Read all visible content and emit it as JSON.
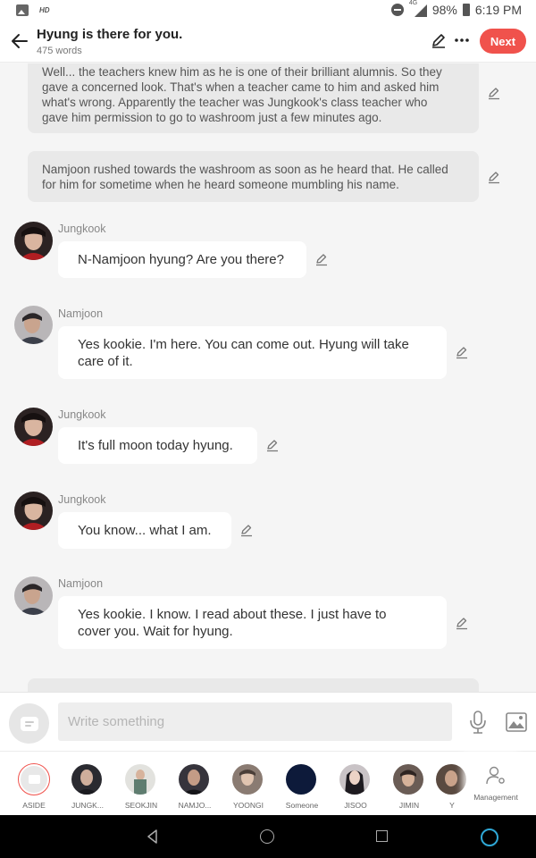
{
  "status_bar": {
    "hd": "HD",
    "network": "4G",
    "battery": "98%",
    "time": "6:19 PM"
  },
  "header": {
    "title": "Hyung is there for you.",
    "word_count": "475 words",
    "next_label": "Next"
  },
  "messages": [
    {
      "type": "narration",
      "lines": [
        "Well... the teachers knew him as he is one of their brilliant alumnis. So they",
        "gave a concerned look. That's when a teacher came to him and asked him",
        "what's wrong. Apparently the teacher was Jungkook's class teacher who",
        "gave him permission to go to washroom just a few minutes ago."
      ]
    },
    {
      "type": "narration",
      "lines": [
        "Namjoon rushed towards the washroom as soon as he heard that. He called",
        "for him for sometime when he heard someone mumbling his name."
      ]
    },
    {
      "type": "dialogue",
      "speaker": "Jungkook",
      "lines": [
        "N-Namjoon hyung? Are you there?"
      ]
    },
    {
      "type": "dialogue",
      "speaker": "Namjoon",
      "lines": [
        "Yes kookie. I'm here. You can come out. Hyung will take",
        "care of it."
      ]
    },
    {
      "type": "dialogue",
      "speaker": "Jungkook",
      "lines": [
        "It's full moon today hyung."
      ]
    },
    {
      "type": "dialogue",
      "speaker": "Jungkook",
      "lines": [
        "You know... what I am."
      ]
    },
    {
      "type": "dialogue",
      "speaker": "Namjoon",
      "lines": [
        "Yes kookie. I know. I read about these. I just have to",
        "cover you. Wait for hyung."
      ]
    }
  ],
  "composer": {
    "placeholder": "Write something"
  },
  "cast": [
    {
      "label": "ASIDE",
      "icon": "aside-icon"
    },
    {
      "label": "JUNGK...",
      "color": "#2a2a30"
    },
    {
      "label": "SEOKJIN",
      "color": "#7c8f88"
    },
    {
      "label": "NAMJO...",
      "color": "#36343c"
    },
    {
      "label": "YOONGI",
      "color": "#8a7b72"
    },
    {
      "label": "Someone",
      "color": "#0d1a3a"
    },
    {
      "label": "JISOO",
      "color": "#c9c3c6"
    },
    {
      "label": "JIMIN",
      "color": "#6a5c55"
    },
    {
      "label": "Y",
      "color": "#5a4a40"
    }
  ],
  "management": {
    "label": "Management",
    "icon": "management-icon"
  },
  "colors": {
    "accent": "#f0524c",
    "bubble": "#ffffff",
    "narration": "#e9e9e9",
    "background": "#f5f5f5"
  }
}
